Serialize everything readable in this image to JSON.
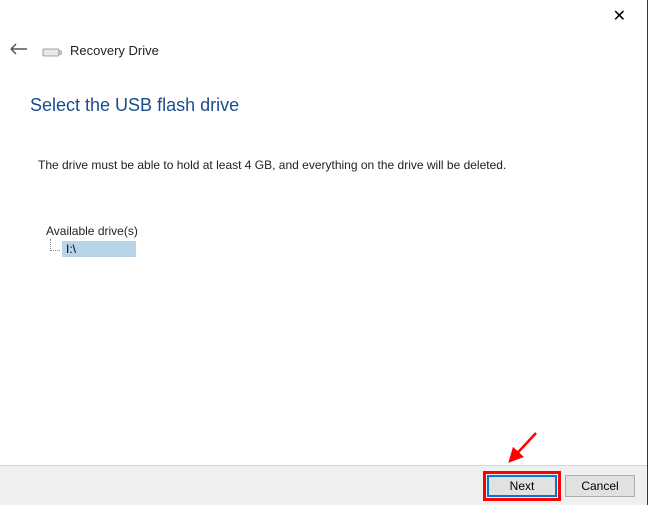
{
  "window": {
    "title": "Recovery Drive",
    "close": "✕"
  },
  "heading": "Select the USB flash drive",
  "description": "The drive must be able to hold at least 4 GB, and everything on the drive will be deleted.",
  "drives": {
    "label": "Available drive(s)",
    "items": [
      "I:\\"
    ]
  },
  "buttons": {
    "next": "Next",
    "cancel": "Cancel"
  }
}
